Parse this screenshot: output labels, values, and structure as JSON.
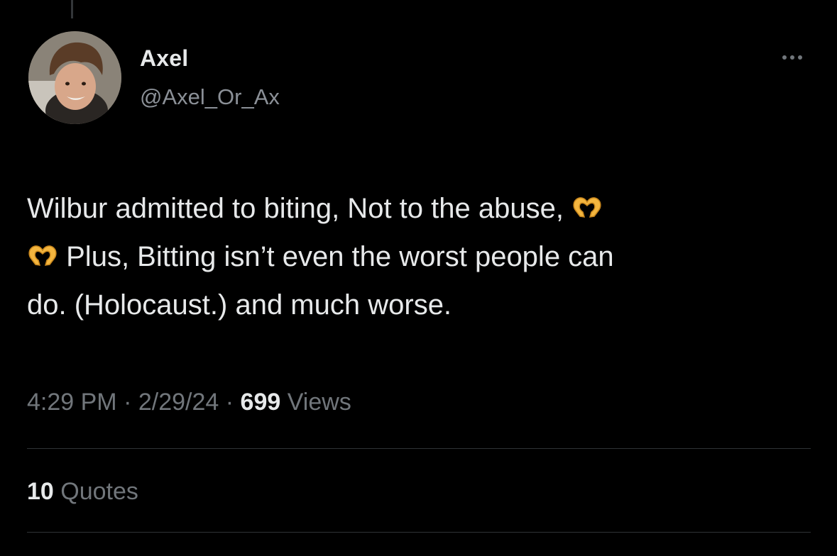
{
  "author": {
    "name": "Axel",
    "handle": "@Axel_Or_Ax"
  },
  "tweet": {
    "line1_text": "Wilbur admitted to biting, Not to the abuse,",
    "line2_text": "Plus, Bitting isn’t even the worst people can",
    "line3_text": "do. (Holocaust.) and much worse.",
    "emoji_icon": "heart-hands"
  },
  "meta": {
    "time": "4:29 PM",
    "separator": "·",
    "date": "2/29/24",
    "views_count": "699",
    "views_label": "Views"
  },
  "stats": {
    "quotes_count": "10",
    "quotes_label": "Quotes"
  },
  "colors": {
    "background": "#000000",
    "primary_text": "#e7e9ea",
    "secondary_text": "#71767b",
    "divider": "#2f3336",
    "emoji": "#f4b63f"
  }
}
